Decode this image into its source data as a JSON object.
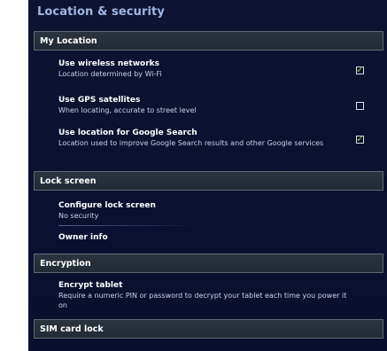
{
  "page_title": "Location & security",
  "sections": {
    "my_location": "My Location",
    "lock_screen": "Lock screen",
    "encryption": "Encryption",
    "sim_card_lock": "SIM card lock"
  },
  "my_location_items": [
    {
      "title": "Use wireless networks",
      "summary": "Location determined by Wi-Fi",
      "checked": true
    },
    {
      "title": "Use GPS satellites",
      "summary": "When locating, accurate to street level",
      "checked": false
    },
    {
      "title": "Use location for Google Search",
      "summary": "Location used to improve Google Search results and other Google services",
      "checked": true
    }
  ],
  "lock_screen_items": [
    {
      "title": "Configure lock screen",
      "summary": "No security"
    },
    {
      "title": "Owner info"
    }
  ],
  "encryption_items": [
    {
      "title": "Encrypt tablet",
      "summary": "Require a numeric PIN or password to decrypt your tablet each time you power it on"
    }
  ],
  "colors": {
    "accent_title": "#9fb7e6",
    "checkmark": "#8fd13a",
    "background": "#0d1330"
  },
  "icons": {
    "checkbox_checked": "check-icon"
  }
}
